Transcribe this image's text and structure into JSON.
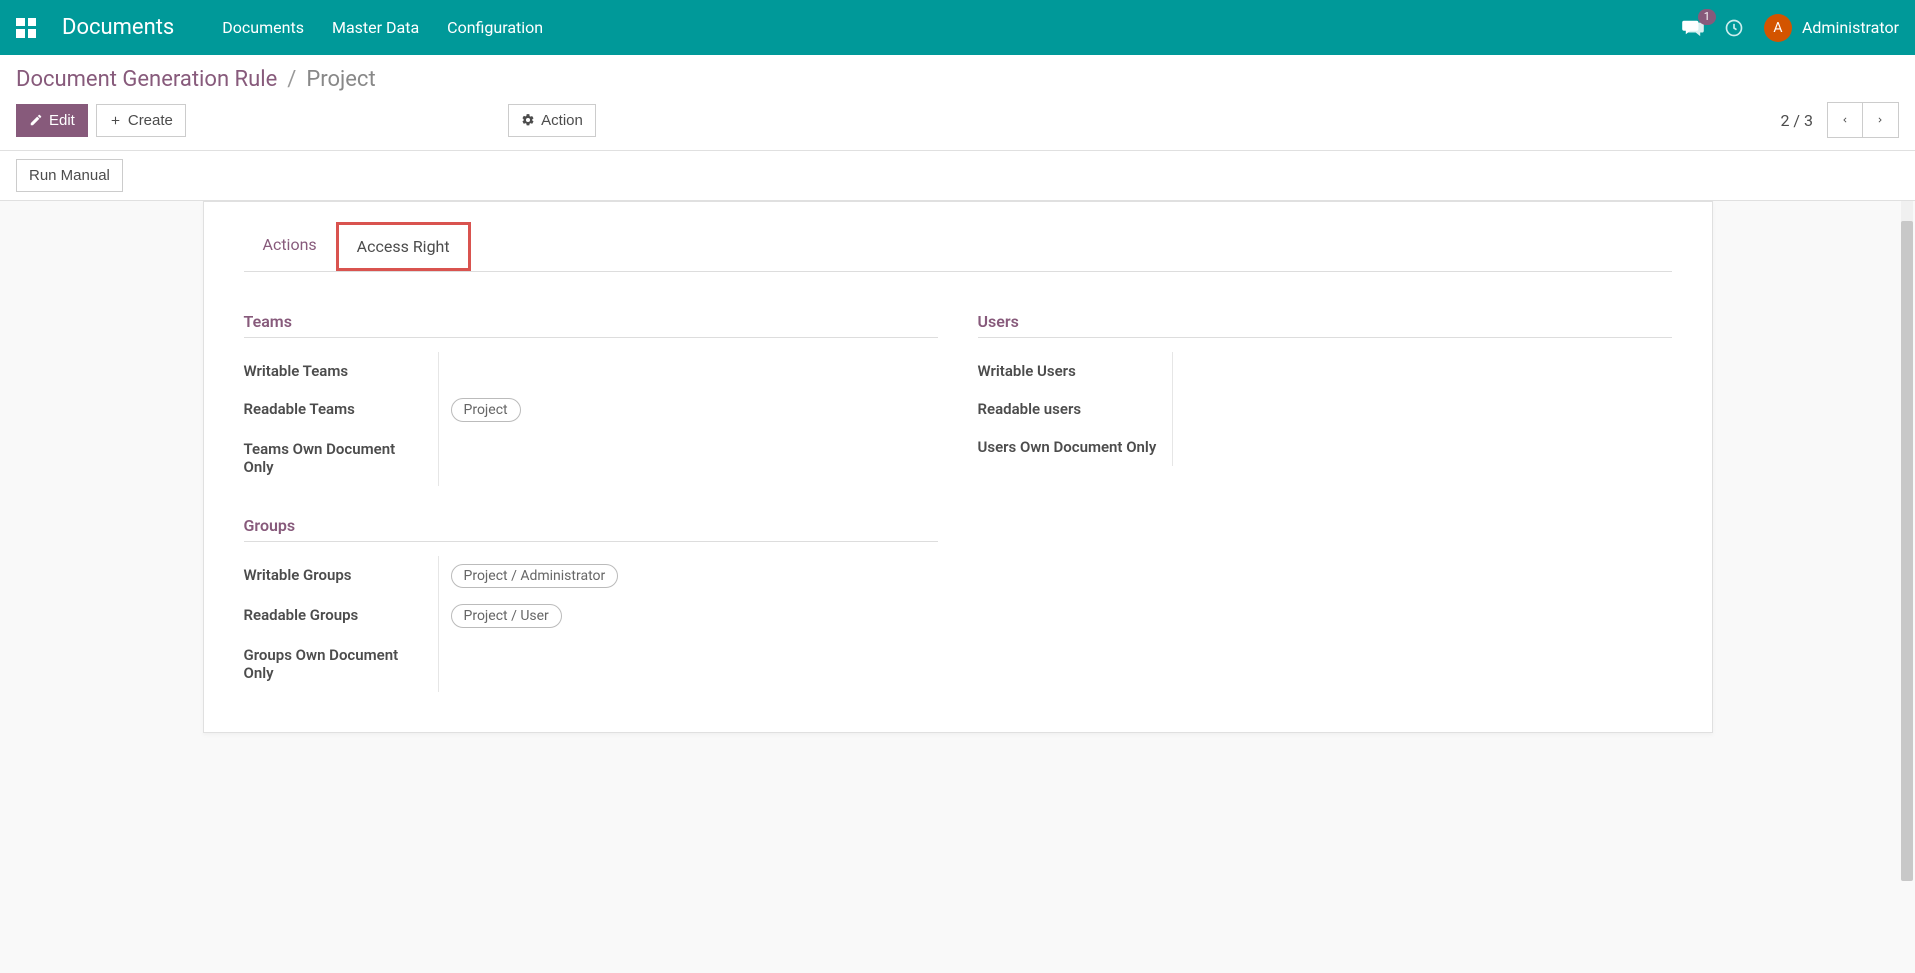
{
  "navbar": {
    "brand": "Documents",
    "menu": [
      "Documents",
      "Master Data",
      "Configuration"
    ],
    "chat_badge": "1",
    "avatar_initial": "A",
    "user_name": "Administrator"
  },
  "breadcrumb": {
    "parent": "Document Generation Rule",
    "sep": "/",
    "current": "Project"
  },
  "buttons": {
    "edit": "Edit",
    "create": "Create",
    "action": "Action",
    "run_manual": "Run Manual"
  },
  "pager": {
    "text": "2 / 3"
  },
  "tabs": [
    {
      "label": "Actions",
      "state": "inactive-purple"
    },
    {
      "label": "Access Right",
      "state": "highlighted"
    }
  ],
  "sections": {
    "teams": {
      "title": "Teams",
      "fields": {
        "writable_label": "Writable Teams",
        "readable_label": "Readable Teams",
        "readable_tags": [
          "Project"
        ],
        "own_label": "Teams Own Document Only"
      }
    },
    "groups": {
      "title": "Groups",
      "fields": {
        "writable_label": "Writable Groups",
        "writable_tags": [
          "Project / Administrator"
        ],
        "readable_label": "Readable Groups",
        "readable_tags": [
          "Project / User"
        ],
        "own_label": "Groups Own Document Only"
      }
    },
    "users": {
      "title": "Users",
      "fields": {
        "writable_label": "Writable Users",
        "readable_label": "Readable users",
        "own_label": "Users Own Document Only"
      }
    }
  }
}
